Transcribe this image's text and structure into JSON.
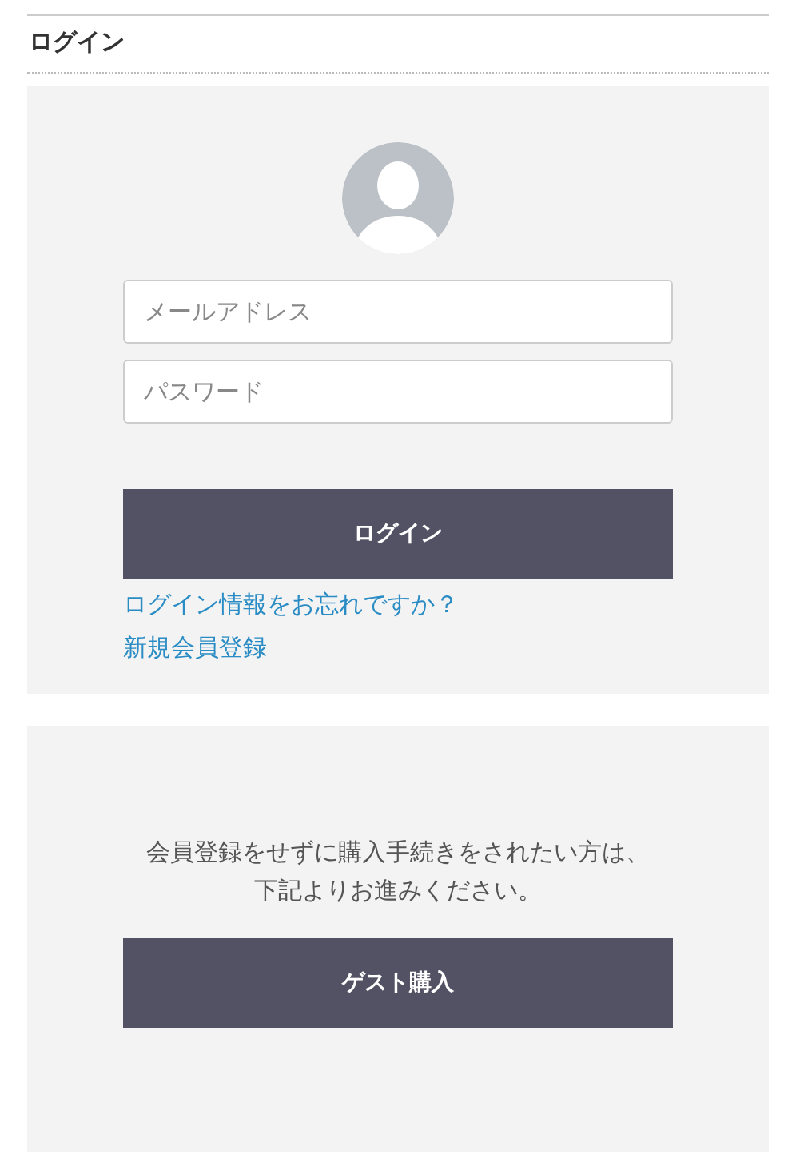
{
  "heading": "ログイン",
  "login_panel": {
    "fields": [
      {
        "placeholder": "メールアドレス"
      },
      {
        "placeholder": "パスワード"
      }
    ],
    "login_button": "ログイン",
    "links": [
      "ログイン情報をお忘れですか？",
      "新規会員登録"
    ]
  },
  "guest_panel": {
    "message_lines": [
      "会員登録をせずに購入手続きをされたい方は、",
      "下記よりお進みください。"
    ],
    "guest_button": "ゲスト購入"
  }
}
